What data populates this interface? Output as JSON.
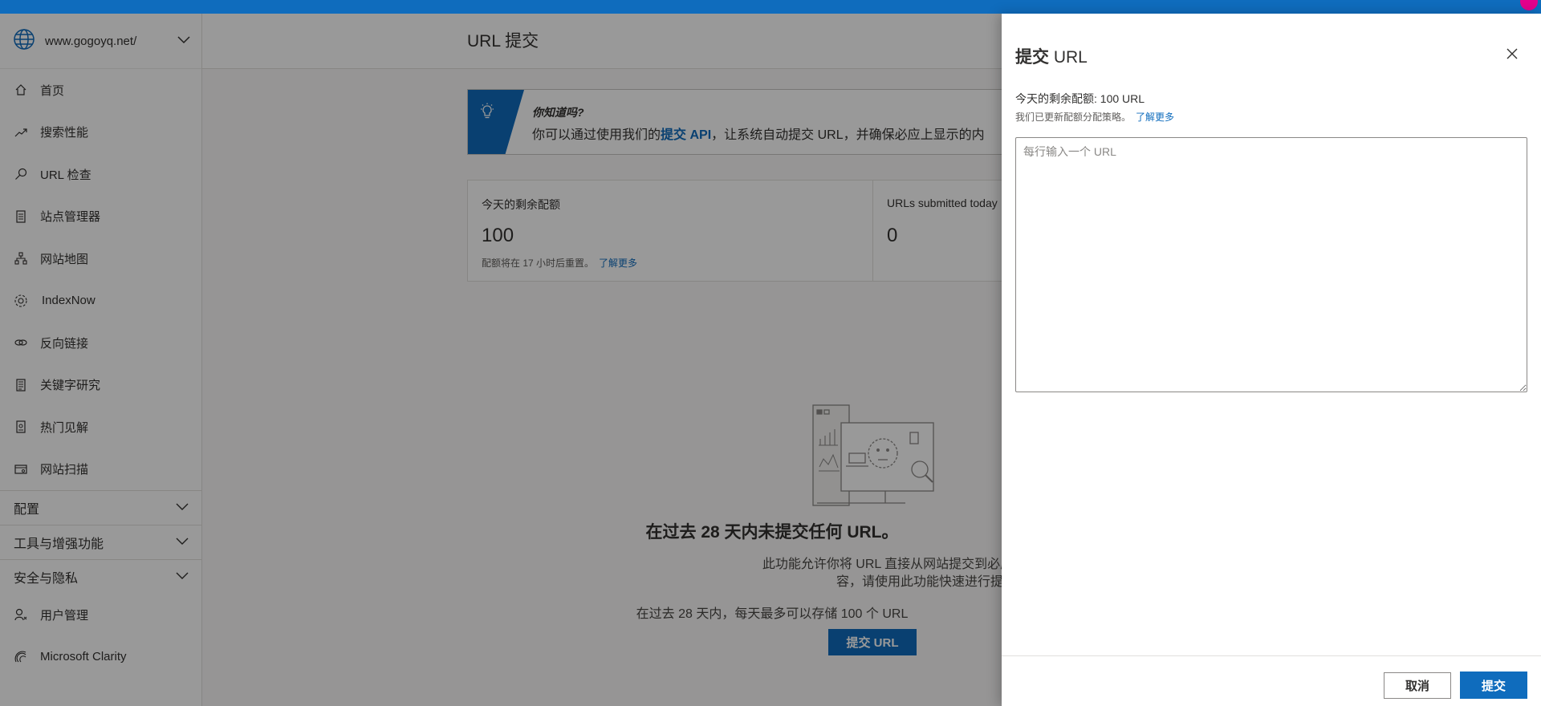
{
  "site": {
    "name": "www.gogoyq.net/"
  },
  "sidebar": {
    "items": [
      {
        "label": "首页",
        "icon": "home-icon"
      },
      {
        "label": "搜索性能",
        "icon": "trend-icon"
      },
      {
        "label": "URL 检查",
        "icon": "search-icon"
      },
      {
        "label": "站点管理器",
        "icon": "document-icon"
      },
      {
        "label": "网站地图",
        "icon": "sitemap-icon"
      },
      {
        "label": "IndexNow",
        "icon": "gear-icon"
      },
      {
        "label": "反向链接",
        "icon": "link-icon"
      },
      {
        "label": "关键字研究",
        "icon": "list-icon"
      },
      {
        "label": "热门见解",
        "icon": "insights-icon"
      },
      {
        "label": "网站扫描",
        "icon": "scan-icon"
      }
    ],
    "groups": [
      {
        "label": "配置"
      },
      {
        "label": "工具与增强功能"
      },
      {
        "label": "安全与隐私"
      }
    ],
    "bottom_items": [
      {
        "label": "用户管理",
        "icon": "user-icon"
      },
      {
        "label": "Microsoft Clarity",
        "icon": "clarity-icon"
      }
    ]
  },
  "main": {
    "page_title": "URL 提交",
    "tip": {
      "title": "你知道吗?",
      "text_before": "你可以通过使用我们的",
      "link": "提交 API",
      "text_after": "，让系统自动提交 URL，并确保必应上显示的内"
    },
    "card_quota": {
      "label": "今天的剩余配额",
      "value": "100",
      "note": "配额将在 17 小时后重置。",
      "link": "了解更多"
    },
    "card_submitted": {
      "label": "URLs submitted today",
      "value": "0"
    },
    "empty": {
      "title": "在过去 28 天内未提交任何 URL。",
      "desc_line1": "此功能允许你将 URL 直接从网站提交到必应索引。如果你要",
      "desc_line2": "容，请使用此功能快速进行提交。",
      "note": "在过去 28 天内，每天最多可以存储 100 个 URL",
      "button": "提交 URL"
    }
  },
  "panel": {
    "title_bold": "提交",
    "title_light": " URL",
    "quota_text": "今天的剩余配额: 100 URL",
    "quota_sub": "我们已更新配额分配策略。",
    "quota_link": "了解更多",
    "textarea_placeholder": "每行输入一个 URL",
    "textarea_value": "",
    "cancel_label": "取消",
    "submit_label": "提交"
  },
  "colors": {
    "accent": "#0f6cbd",
    "overlay": "rgba(0,0,0,0.4)",
    "avatar": "#e3008c"
  }
}
